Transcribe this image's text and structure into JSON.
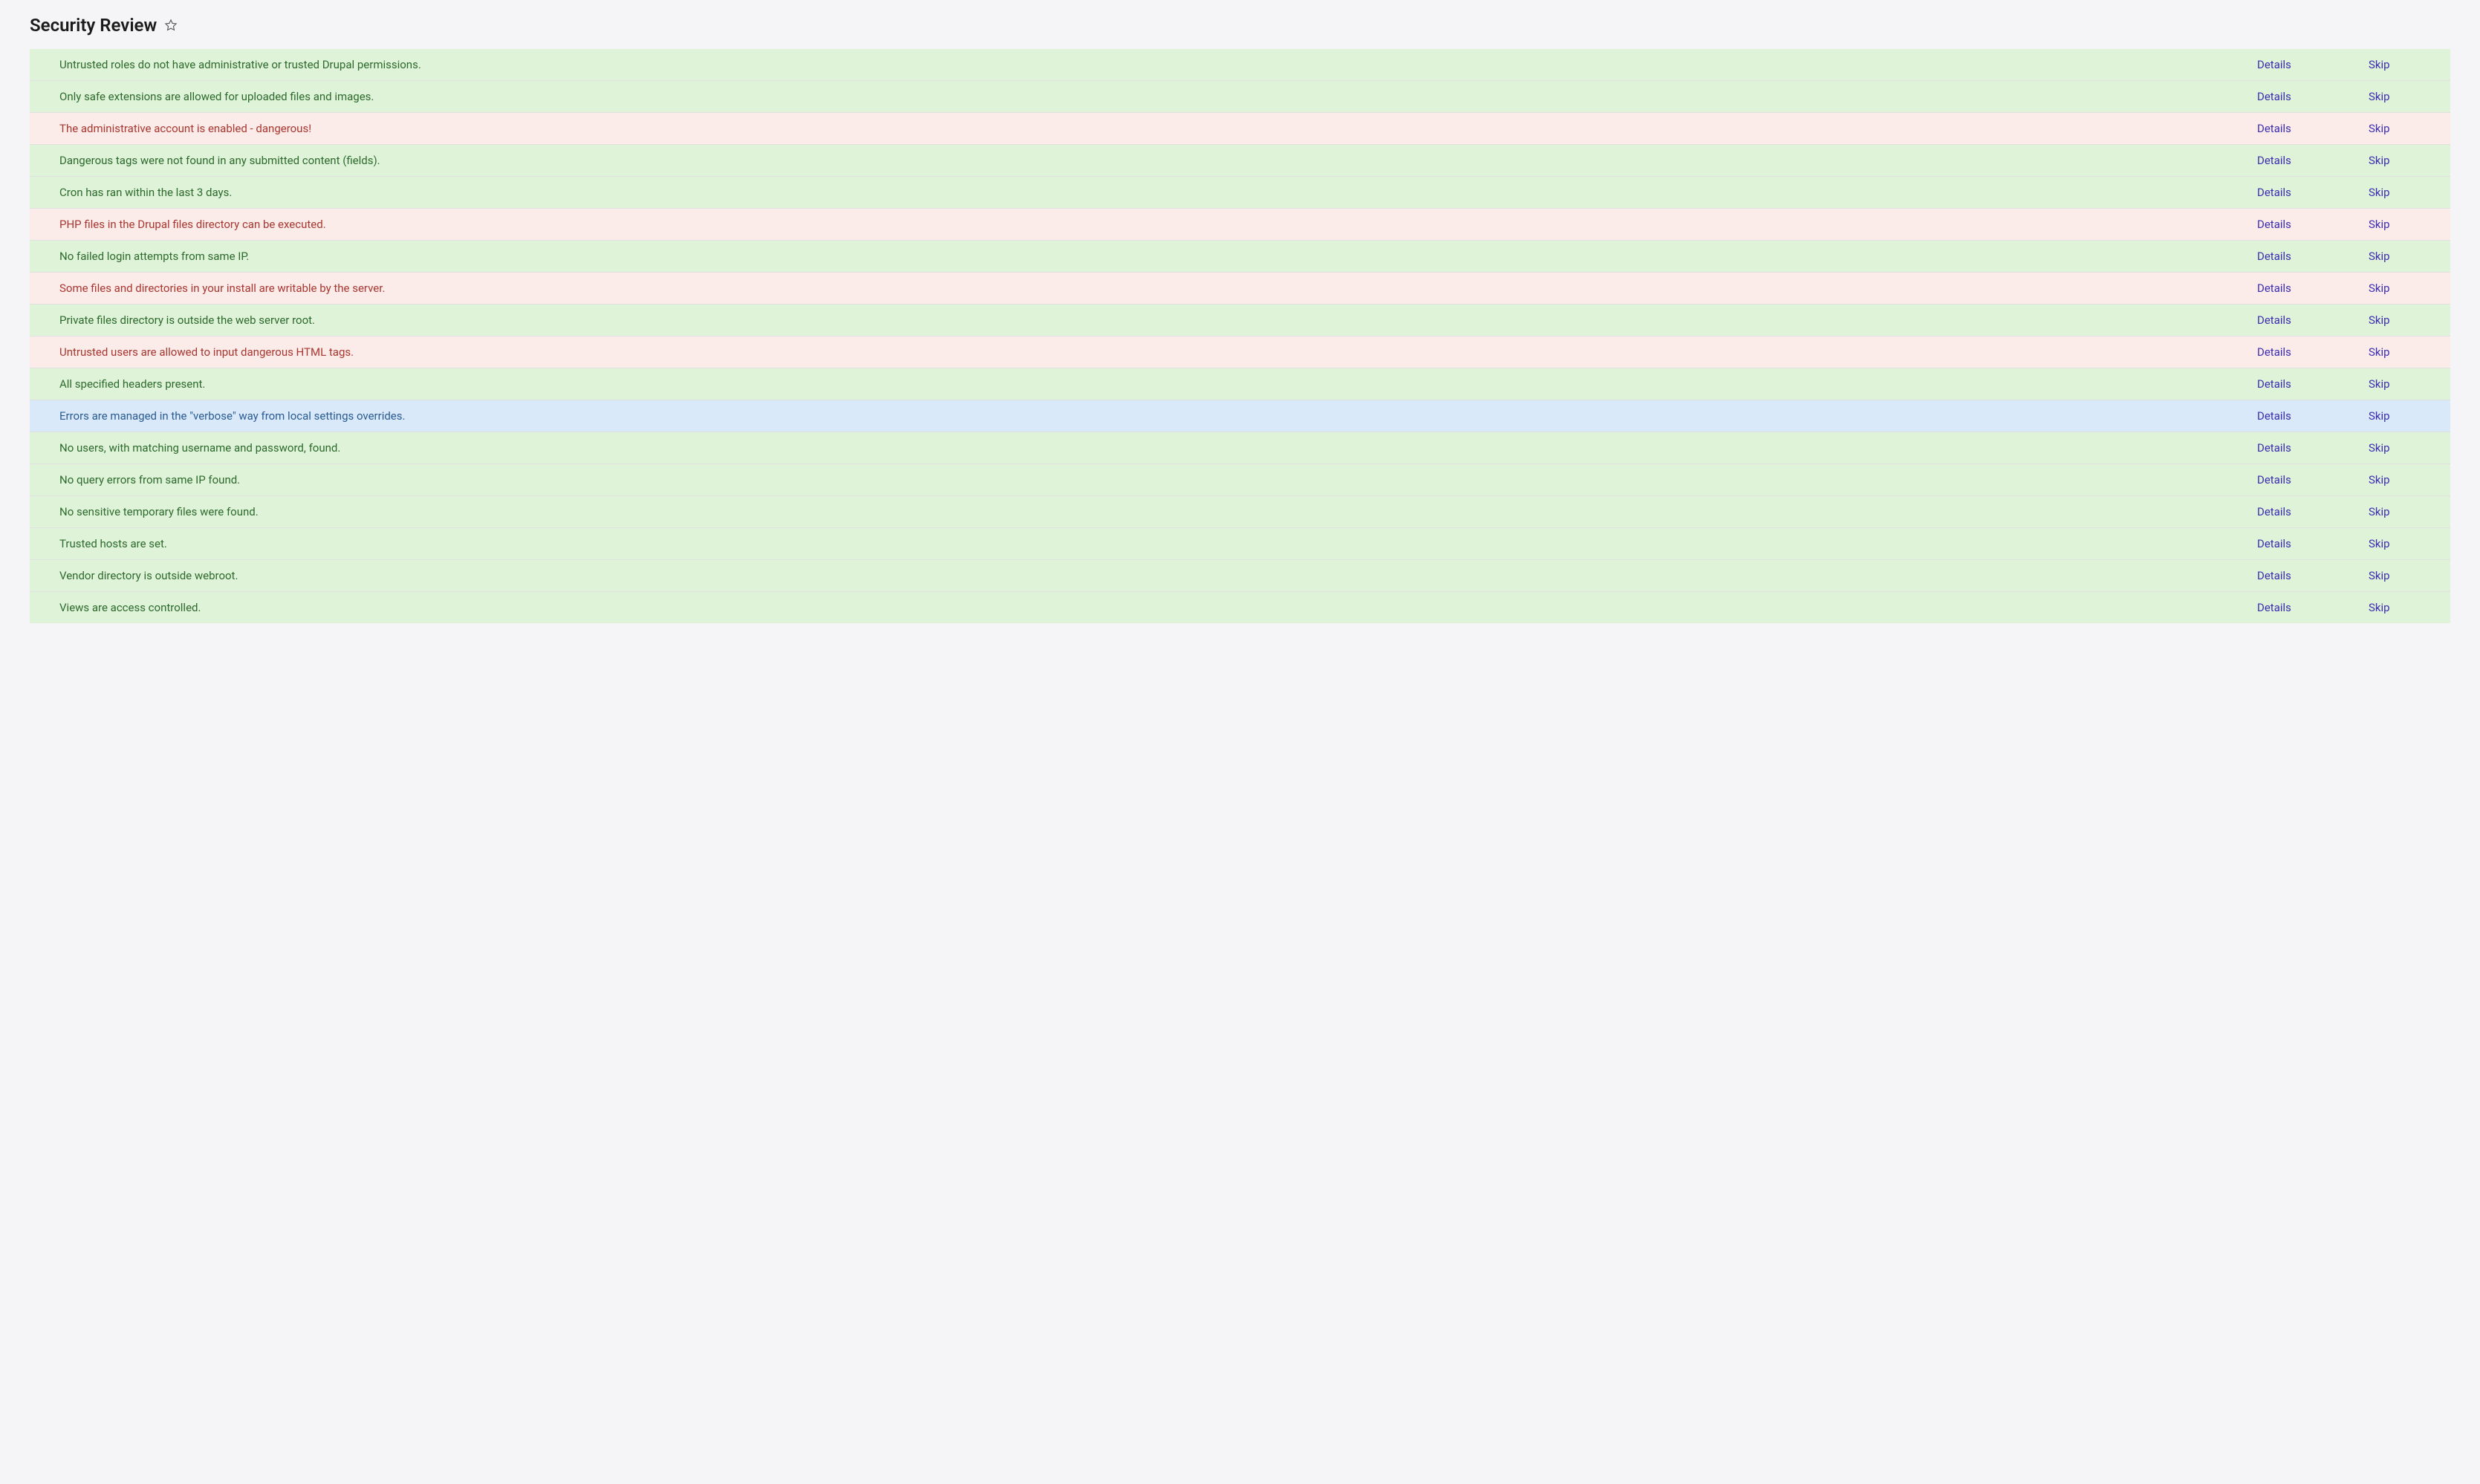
{
  "page": {
    "title": "Security Review"
  },
  "labels": {
    "details": "Details",
    "skip": "Skip"
  },
  "checks": [
    {
      "status": "pass",
      "message": "Untrusted roles do not have administrative or trusted Drupal permissions."
    },
    {
      "status": "pass",
      "message": "Only safe extensions are allowed for uploaded files and images."
    },
    {
      "status": "fail",
      "message": "The administrative account is enabled - dangerous!"
    },
    {
      "status": "pass",
      "message": "Dangerous tags were not found in any submitted content (fields)."
    },
    {
      "status": "pass",
      "message": "Cron has ran within the last 3 days."
    },
    {
      "status": "fail",
      "message": "PHP files in the Drupal files directory can be executed."
    },
    {
      "status": "pass",
      "message": "No failed login attempts from same IP."
    },
    {
      "status": "fail",
      "message": "Some files and directories in your install are writable by the server."
    },
    {
      "status": "pass",
      "message": "Private files directory is outside the web server root."
    },
    {
      "status": "fail",
      "message": "Untrusted users are allowed to input dangerous HTML tags."
    },
    {
      "status": "pass",
      "message": "All specified headers present."
    },
    {
      "status": "info",
      "message": "Errors are managed in the \"verbose\" way from local settings overrides."
    },
    {
      "status": "pass",
      "message": "No users, with matching username and password, found."
    },
    {
      "status": "pass",
      "message": "No query errors from same IP found."
    },
    {
      "status": "pass",
      "message": "No sensitive temporary files were found."
    },
    {
      "status": "pass",
      "message": "Trusted hosts are set."
    },
    {
      "status": "pass",
      "message": "Vendor directory is outside webroot."
    },
    {
      "status": "pass",
      "message": "Views are access controlled."
    }
  ]
}
